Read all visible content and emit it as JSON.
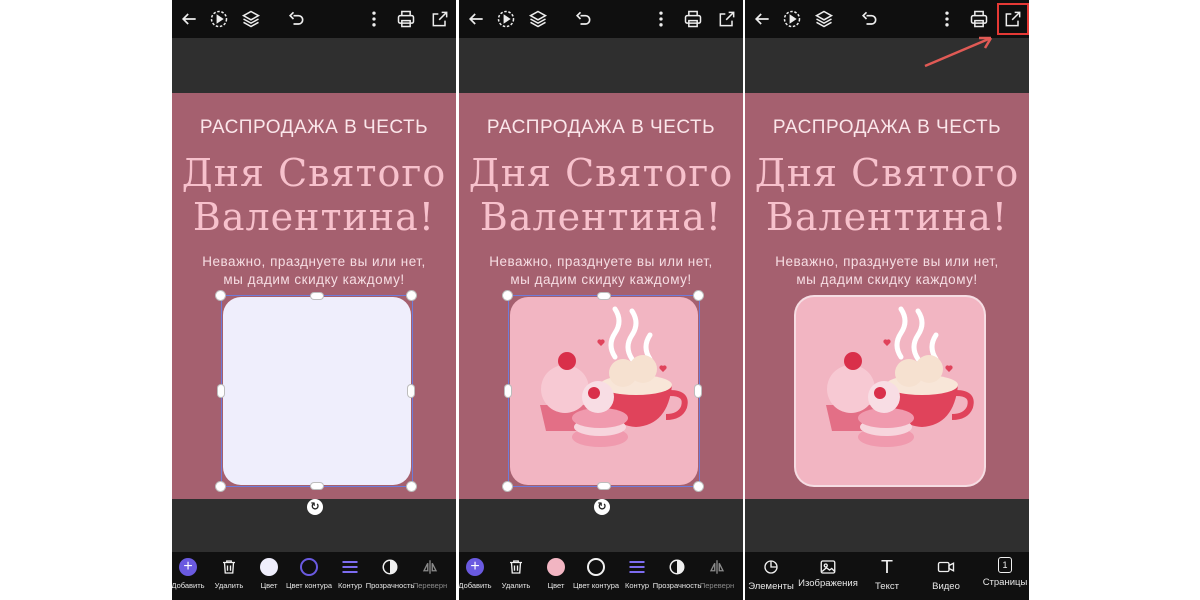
{
  "canvas": {
    "line1": "РАСПРОДАЖА В ЧЕСТЬ",
    "line2": "Дня Святого",
    "line3": "Валентина!",
    "sub1": "Неважно, празднуете вы или нет,",
    "sub2": "мы дадим скидку каждому!"
  },
  "edit_toolbar": {
    "add": "Добавить",
    "delete": "Удалить",
    "color": "Цвет",
    "outline_color": "Цвет контура",
    "outline": "Контур",
    "opacity": "Прозрачность",
    "flip": "Переверн"
  },
  "main_toolbar": {
    "elements": "Элементы",
    "images": "Изображения",
    "text": "Текст",
    "video": "Видео",
    "pages": "Страницы",
    "pages_count": "1"
  },
  "colors": {
    "canvas_bg": "#a5606f",
    "accent": "#6a5ae0",
    "highlight": "#e53935",
    "white_fill": "#efeefc",
    "pink_fill": "#f2b5c2"
  },
  "icons": [
    "back-arrow-icon",
    "play-icon",
    "layers-icon",
    "undo-icon",
    "more-icon",
    "print-icon",
    "share-icon"
  ]
}
